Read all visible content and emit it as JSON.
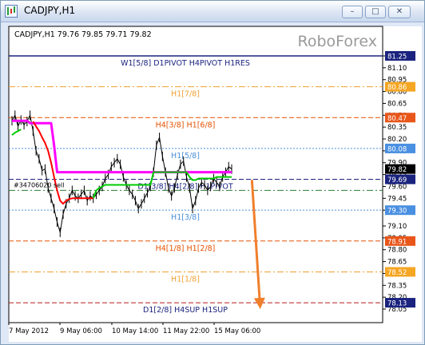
{
  "window": {
    "title": "CADJPY,H1",
    "min_icon": "minimize-icon",
    "max_icon": "maximize-icon",
    "close_icon": "close-icon",
    "min_glyph": "–",
    "max_glyph": "□",
    "close_glyph": "✕"
  },
  "chart_data": {
    "type": "line",
    "symbol_header": "CADJPY,H1  79.76 79.85 79.71 79.82",
    "watermark": "RoboForex",
    "ylim": [
      78.05,
      81.25
    ],
    "y_ticks": [
      81.25,
      81.1,
      80.95,
      80.8,
      80.65,
      80.5,
      80.35,
      80.2,
      80.05,
      79.9,
      79.75,
      79.6,
      79.45,
      79.3,
      79.1,
      78.95,
      78.8,
      78.65,
      78.5,
      78.35,
      78.2,
      78.05
    ],
    "y_tick_labels": [
      "81.25",
      "81.10",
      "80.95",
      "80.80",
      "80.65",
      "80.50",
      "80.35",
      "80.20",
      "80.05",
      "79.90",
      "79.75",
      "79.60",
      "79.45",
      "79.30",
      "79.10",
      "78.95",
      "78.80",
      "78.65",
      "78.50",
      "78.35",
      "78.20",
      "78.05"
    ],
    "x_tick_labels": [
      "7 May 2012",
      "9 May 06:00",
      "10 May 14:00",
      "11 May 22:00",
      "15 May 06:00"
    ],
    "levels": [
      {
        "value": 81.25,
        "label": "W1[5/8] D1PIVOT H4PIVOT H1RES",
        "price_label": "81.25",
        "color": "#1a237e",
        "style": "solid",
        "label_color": "#1a237e",
        "axis_bg": "#1a237e"
      },
      {
        "value": 80.86,
        "label": "H1[7/8]",
        "price_label": "80.86",
        "color": "#f0a030",
        "style": "dashdot",
        "label_color": "#f0a030",
        "axis_bg": "#f5a623"
      },
      {
        "value": 80.47,
        "label": "H4[3/8] H1[6/8]",
        "price_label": "80.47",
        "color": "#e65100",
        "style": "dashed",
        "label_color": "#e65100",
        "axis_bg": "#e8561a"
      },
      {
        "value": 80.08,
        "label": "H1[5/8]",
        "price_label": "80.08",
        "color": "#4a90d9",
        "style": "dotted",
        "label_color": "#4a90d9",
        "axis_bg": "#4a90e2"
      },
      {
        "value": 79.69,
        "label": "D1[3/8] H4[2/8] H1PIVOT",
        "price_label": "79.69",
        "color": "#1a237e",
        "style": "dashed",
        "label_color": "#1a237e",
        "axis_bg": "#1a237e"
      },
      {
        "value": 79.55,
        "label": "",
        "price_label": "",
        "color": "#2e7d32",
        "style": "dashdot",
        "label_color": "#2e7d32",
        "axis_bg": ""
      },
      {
        "value": 79.3,
        "label": "H1[3/8]",
        "price_label": "79.30",
        "color": "#4a90d9",
        "style": "dotted",
        "label_color": "#4a90d9",
        "axis_bg": "#4a90e2"
      },
      {
        "value": 78.91,
        "label": "H4[1/8] H1[2/8]",
        "price_label": "78.91",
        "color": "#e65100",
        "style": "dashed",
        "label_color": "#e65100",
        "axis_bg": "#e8561a"
      },
      {
        "value": 78.52,
        "label": "H1[1/8]",
        "price_label": "78.52",
        "color": "#f0a030",
        "style": "dashdot",
        "label_color": "#f0a030",
        "axis_bg": "#f5a623"
      },
      {
        "value": 78.13,
        "label": "D1[2/8] H4SUP H1SUP",
        "price_label": "78.13",
        "color": "#b71c1c",
        "style": "dashed",
        "label_color": "#1a237e",
        "axis_bg": "#1a237e"
      }
    ],
    "current_price": {
      "value": 79.82,
      "label": "79.82"
    },
    "order_label": "#34706020 sell",
    "series": [
      {
        "color": "#000000",
        "values": [
          80.43,
          80.5,
          80.36,
          80.44,
          80.38,
          80.42,
          80.5,
          80.3,
          80.05,
          79.95,
          79.8,
          79.82,
          79.58,
          79.45,
          79.32,
          79.15,
          79.02,
          79.25,
          79.38,
          79.45,
          79.55,
          79.48,
          79.45,
          79.5,
          79.55,
          79.42,
          79.48,
          79.45,
          79.5,
          79.55,
          79.6,
          79.7,
          79.75,
          79.85,
          79.9,
          79.95,
          79.88,
          79.72,
          79.62,
          79.55,
          79.5,
          79.42,
          79.32,
          79.38,
          79.45,
          79.52,
          79.6,
          79.78,
          80.12,
          80.22,
          79.98,
          79.78,
          79.58,
          79.48,
          79.58,
          79.75,
          79.88,
          79.92,
          79.72,
          79.58,
          79.32,
          79.42,
          79.58,
          79.65,
          79.62,
          79.55,
          79.6,
          79.7,
          79.65,
          79.6,
          79.72,
          79.78,
          79.85,
          79.82
        ]
      },
      {
        "color": "#ff00ff",
        "values": [
          80.43,
          80.43,
          80.43,
          80.43,
          80.43,
          80.43,
          80.4,
          80.4,
          80.4,
          80.4,
          80.4,
          80.4,
          80.4,
          80.4,
          80.12,
          79.78,
          79.78,
          79.78,
          79.78,
          79.78,
          79.78,
          79.78,
          79.78,
          79.78,
          79.78,
          79.78,
          79.78,
          79.78,
          79.78,
          79.78,
          79.78,
          79.78,
          79.78,
          79.78,
          79.78,
          79.78,
          79.78,
          79.78,
          79.78,
          79.78,
          79.78,
          79.78,
          79.78,
          79.78,
          79.78,
          79.78,
          79.78,
          79.78,
          79.78,
          79.78,
          79.78,
          79.78,
          79.78,
          79.78,
          79.78,
          79.78,
          79.78,
          79.78,
          79.78,
          79.78,
          79.78,
          79.78,
          79.78,
          79.78,
          79.78,
          79.78,
          79.78,
          79.78,
          79.78,
          79.78,
          79.78,
          79.78,
          79.78,
          79.78
        ]
      },
      {
        "color": "#ff0000",
        "values": [
          null,
          null,
          null,
          null,
          null,
          null,
          null,
          80.42,
          80.36,
          80.3,
          80.22,
          80.15,
          80.05,
          79.9,
          79.72,
          79.55,
          79.42,
          79.38,
          79.42,
          79.44,
          79.45,
          79.45,
          79.45,
          79.45,
          79.45,
          79.45,
          79.45,
          79.45,
          null,
          null,
          null,
          null,
          null,
          null,
          null,
          null,
          null,
          null,
          null,
          null,
          null,
          null,
          null,
          null,
          null,
          null,
          null,
          null,
          null,
          null,
          null,
          null,
          null,
          null,
          null,
          null,
          null,
          null,
          null,
          null,
          null,
          null,
          null,
          null,
          null,
          null,
          null,
          null,
          null,
          null,
          null,
          null,
          null,
          79.7
        ]
      },
      {
        "color": "#00cc00",
        "values": [
          80.25,
          80.28,
          80.3,
          80.32,
          null,
          null,
          null,
          null,
          null,
          null,
          null,
          null,
          null,
          null,
          null,
          null,
          null,
          null,
          null,
          null,
          null,
          null,
          null,
          null,
          null,
          null,
          null,
          79.45,
          79.55,
          79.58,
          79.6,
          79.62,
          79.62,
          79.62,
          79.62,
          79.62,
          79.62,
          79.62,
          79.62,
          79.62,
          79.62,
          79.62,
          79.62,
          79.62,
          79.62,
          79.62,
          79.62,
          79.78,
          79.78,
          79.78,
          79.78,
          79.78,
          79.78,
          79.78,
          79.78,
          79.78,
          79.78,
          79.78,
          79.78,
          79.72,
          79.68,
          79.68,
          79.7,
          79.7,
          79.7,
          79.7,
          79.7,
          79.7,
          79.72,
          79.72,
          79.72,
          79.72,
          79.72,
          79.72
        ]
      }
    ],
    "arrow": {
      "color": "#f07f2c",
      "from": [
        79.67,
        79.75
      ],
      "to": [
        78.05,
        82.5
      ],
      "x_scale": "bar-index"
    }
  }
}
